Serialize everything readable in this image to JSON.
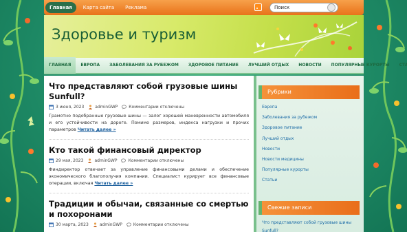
{
  "top_nav": {
    "items": [
      "Главная",
      "Карта сайта",
      "Реклама"
    ]
  },
  "search": {
    "value": "Поиск"
  },
  "site": {
    "title": "Здоровье и туризм"
  },
  "main_nav": {
    "items": [
      "ГЛАВНАЯ",
      "ЕВРОПА",
      "ЗАБОЛЕВАНИЯ ЗА РУБЕЖОМ",
      "ЗДОРОВОЕ ПИТАНИЕ",
      "ЛУЧШИЙ ОТДЫХ",
      "НОВОСТИ",
      "ПОПУЛЯРНЫЕ КУРОРТЫ",
      "СТАТЬИ"
    ]
  },
  "posts": [
    {
      "title": "Что представляют собой грузовые шины Sunfull?",
      "date": "3 июня, 2023",
      "author": "adminGWP",
      "comments": "Комментарии отключены",
      "excerpt": "Грамотно подобранные грузовые шины — залог хорошей маневренности автомобиля и его устойчивости на дороге. Помимо размеров, индекса нагрузки и прочих параметров",
      "read_more": "Читать далее »"
    },
    {
      "title": "Кто такой финансовый директор",
      "date": "29 мая, 2023",
      "author": "adminGWP",
      "comments": "Комментарии отключены",
      "excerpt": "Финдиректор отвечает за управление финансовыми делами и обеспечение экономического благополучия компании. Специалист курирует все финансовые операции, включая",
      "read_more": "Читать далее »"
    },
    {
      "title": "Традиции и обычаи, связанные со смертью и похоронами",
      "date": "30 марта, 2023",
      "author": "adminGWP",
      "comments": "Комментарии отключены"
    }
  ],
  "sidebar": {
    "rubrics_title": "Рубрики",
    "rubrics": [
      "Европа",
      "Заболевания за рубежом",
      "Здоровое питание",
      "Лучший отдых",
      "Новости",
      "Новости медицины",
      "Популярные курорты",
      "Статьи"
    ],
    "recent_title": "Свежие записи",
    "recent": [
      "Что представляют собой грузовые шины Sunfull?"
    ]
  },
  "colors": {
    "accent_orange": "#e8731a",
    "title_green": "#195e35",
    "link_blue": "#1a5e9c"
  }
}
